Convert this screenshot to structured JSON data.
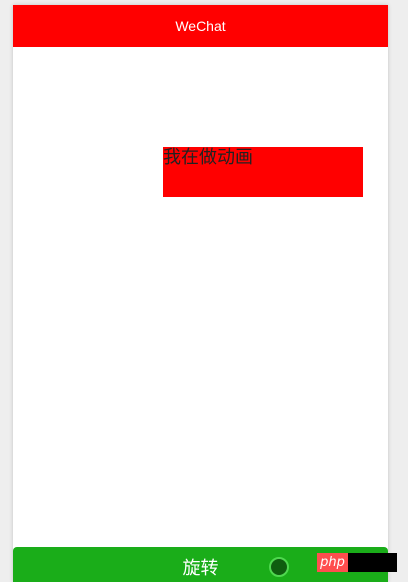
{
  "app": {
    "title": "WeChat"
  },
  "main": {
    "animated_text": "我在做动画"
  },
  "footer": {
    "button_label": "旋转"
  },
  "watermark": {
    "label": "php"
  },
  "colors": {
    "nav_bar": "#ff0000",
    "animated_box": "#ff0000",
    "button": "#1aad19",
    "page_background": "#eeeeee"
  },
  "icons": {
    "loading": "loading-circle-icon"
  }
}
